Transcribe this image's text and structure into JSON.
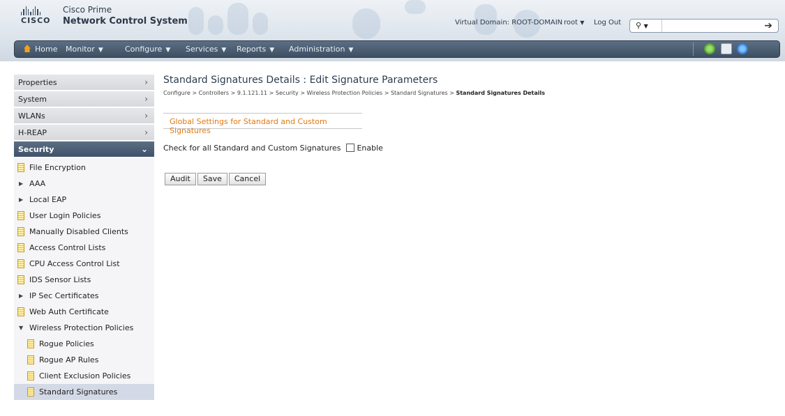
{
  "header": {
    "brand_word": "CISCO",
    "product_line1": "Cisco Prime",
    "product_line2": "Network Control System",
    "virtual_domain": "Virtual Domain: ROOT-DOMAIN",
    "user": "root",
    "logout": "Log Out",
    "search_value": ""
  },
  "nav": {
    "home": "Home",
    "monitor": "Monitor",
    "configure": "Configure",
    "services": "Services",
    "reports": "Reports",
    "administration": "Administration"
  },
  "sidebar": {
    "sections": [
      "Properties",
      "System",
      "WLANs",
      "H-REAP"
    ],
    "active_section": "Security",
    "items": [
      {
        "label": "File Encryption"
      },
      {
        "label": "AAA"
      },
      {
        "label": "Local EAP"
      },
      {
        "label": "User Login Policies"
      },
      {
        "label": "Manually Disabled Clients"
      },
      {
        "label": "Access Control Lists"
      },
      {
        "label": "CPU Access Control List"
      },
      {
        "label": "IDS Sensor Lists"
      },
      {
        "label": "IP Sec Certificates"
      },
      {
        "label": "Web Auth Certificate"
      },
      {
        "label": "Wireless Protection Policies"
      },
      {
        "label": "Rogue Policies"
      },
      {
        "label": "Rogue AP Rules"
      },
      {
        "label": "Client Exclusion Policies"
      },
      {
        "label": "Standard Signatures"
      }
    ]
  },
  "main": {
    "title": "Standard Signatures Details : Edit Signature Parameters",
    "breadcrumb": "Configure > Controllers > 9.1.121.11 > Security > Wireless Protection Policies > Standard Signatures > ",
    "breadcrumb_current": "Standard Signatures Details",
    "section_title": "Global Settings for Standard and Custom Signatures",
    "check_label": "Check for all Standard and Custom Signatures",
    "enable_label": "Enable",
    "enable_checked": false,
    "buttons": {
      "audit": "Audit",
      "save": "Save",
      "cancel": "Cancel"
    }
  }
}
